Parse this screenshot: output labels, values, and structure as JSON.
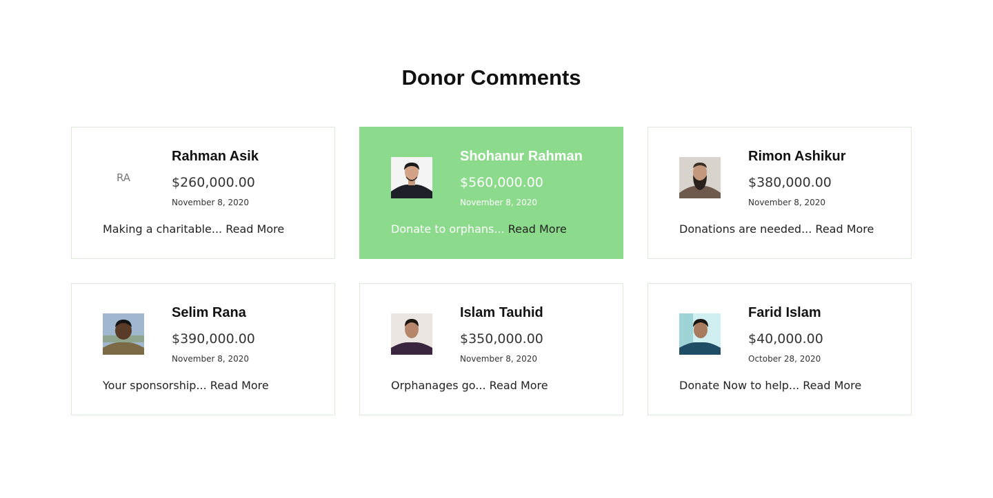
{
  "section": {
    "title": "Donor Comments"
  },
  "colors": {
    "active_card_bg": "#8cdb8c",
    "card_border": "#dcebd9",
    "text": "#111111"
  },
  "donors": [
    {
      "name": "Rahman Asik",
      "initials": "RA",
      "amount": "$260,000.00",
      "date": "November 8, 2020",
      "excerpt": "Making a charitable...",
      "read_more": "Read More",
      "active": false
    },
    {
      "name": "Shohanur Rahman",
      "amount": "$560,000.00",
      "date": "November 8, 2020",
      "excerpt": "Donate to orphans...",
      "read_more": "Read More",
      "active": true
    },
    {
      "name": "Rimon Ashikur",
      "amount": "$380,000.00",
      "date": "November 8, 2020",
      "excerpt": "Donations are needed...",
      "read_more": "Read More",
      "active": false
    },
    {
      "name": "Selim Rana",
      "amount": "$390,000.00",
      "date": "November 8, 2020",
      "excerpt": "Your sponsorship...",
      "read_more": "Read More",
      "active": false
    },
    {
      "name": "Islam Tauhid",
      "amount": "$350,000.00",
      "date": "November 8, 2020",
      "excerpt": "Orphanages go...",
      "read_more": "Read More",
      "active": false
    },
    {
      "name": "Farid Islam",
      "amount": "$40,000.00",
      "date": "October 28, 2020",
      "excerpt": "Donate Now to help...",
      "read_more": "Read More",
      "active": false
    }
  ]
}
